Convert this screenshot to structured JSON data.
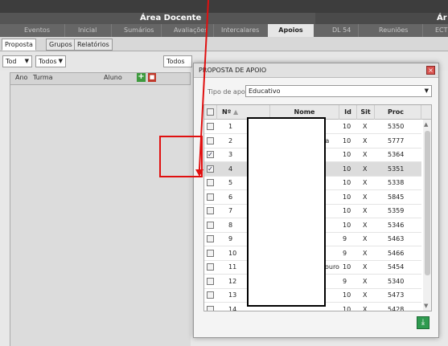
{
  "topbar": {
    "text": ""
  },
  "area": {
    "title": "Área Docente",
    "title_right": "Ár"
  },
  "nav": [
    "Eventos",
    "Inicial",
    "Sumários",
    "Avaliações",
    "Intercalares",
    "Apoios",
    "DL 54",
    "Reuniões",
    "ECT"
  ],
  "nav_active": "Apoios",
  "subtabs": [
    "Proposta",
    "Grupos",
    "Relatórios"
  ],
  "filters": {
    "f1": "Tod",
    "f2": "Todos",
    "f3": "Todos"
  },
  "left_grid": {
    "cols": [
      "Ano",
      "Turma",
      "Aluno"
    ]
  },
  "modal": {
    "title": "PROPOSTA DE APOIO",
    "tipo_label": "Tipo de apoio",
    "tipo_value": "Educativo",
    "headers": [
      "Nº",
      "Nome",
      "Id",
      "Sit",
      "Proc"
    ],
    "rows": [
      {
        "n": "1",
        "nome": "",
        "id": "10",
        "sit": "X",
        "proc": "5350",
        "checked": false
      },
      {
        "n": "2",
        "nome": "eira",
        "id": "10",
        "sit": "X",
        "proc": "5777",
        "checked": false
      },
      {
        "n": "3",
        "nome": "",
        "id": "10",
        "sit": "X",
        "proc": "5364",
        "checked": true
      },
      {
        "n": "4",
        "nome": "",
        "id": "10",
        "sit": "X",
        "proc": "5351",
        "checked": true
      },
      {
        "n": "5",
        "nome": "",
        "id": "10",
        "sit": "X",
        "proc": "5338",
        "checked": false
      },
      {
        "n": "6",
        "nome": "",
        "id": "10",
        "sit": "X",
        "proc": "5845",
        "checked": false
      },
      {
        "n": "7",
        "nome": "",
        "id": "10",
        "sit": "X",
        "proc": "5359",
        "checked": false
      },
      {
        "n": "8",
        "nome": "",
        "id": "10",
        "sit": "X",
        "proc": "5346",
        "checked": false
      },
      {
        "n": "9",
        "nome": "",
        "id": "9",
        "sit": "X",
        "proc": "5463",
        "checked": false
      },
      {
        "n": "10",
        "nome": "",
        "id": "9",
        "sit": "X",
        "proc": "5466",
        "checked": false
      },
      {
        "n": "11",
        "nome": "adouro",
        "id": "10",
        "sit": "X",
        "proc": "5454",
        "checked": false
      },
      {
        "n": "12",
        "nome": "",
        "id": "9",
        "sit": "X",
        "proc": "5340",
        "checked": false
      },
      {
        "n": "13",
        "nome": "",
        "id": "10",
        "sit": "X",
        "proc": "5473",
        "checked": false
      },
      {
        "n": "14",
        "nome": "",
        "id": "10",
        "sit": "X",
        "proc": "5428",
        "checked": false
      }
    ],
    "selected_row": 4
  },
  "icons": {
    "add": "plus-icon",
    "delete": "trash-icon",
    "close": "close-icon",
    "save": "download-icon"
  },
  "colors": {
    "accent_red": "#e01010",
    "add_green": "#3e9a3e",
    "save_green": "#2e9a4f"
  }
}
